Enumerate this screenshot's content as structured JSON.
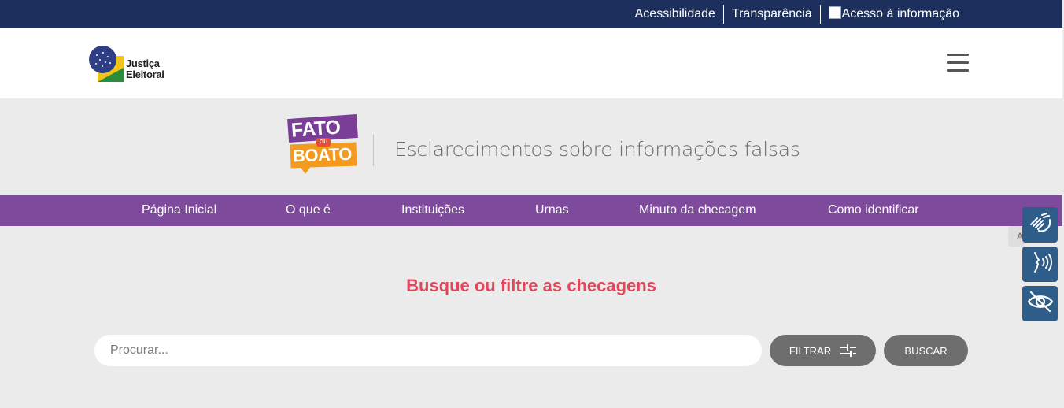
{
  "topbar": {
    "links": [
      "Acessibilidade",
      "Transparência",
      "Acesso à informação"
    ]
  },
  "header": {
    "logo_lines": [
      "Justiça",
      "Eleitoral"
    ],
    "menu_icon": "hamburger-icon"
  },
  "banner": {
    "logo_top": "FATO",
    "logo_mid": "OU",
    "logo_bottom": "BOATO",
    "tagline": "Esclarecimentos sobre informações falsas"
  },
  "nav": {
    "items": [
      "Página Inicial",
      "O que é",
      "Instituições",
      "Urnas",
      "Minuto da checagem",
      "Como identificar"
    ]
  },
  "main": {
    "title": "Busque ou filtre as checagens",
    "search_placeholder": "Procurar...",
    "filter_label": "FILTRAR",
    "search_button": "BUSCAR"
  },
  "side_tools": {
    "tab_text": "A",
    "icons": [
      "sign-language-icon",
      "voice-reader-icon",
      "hide-eye-icon"
    ]
  },
  "colors": {
    "topbar": "#1d2f5c",
    "nav": "#7e4a9c",
    "title": "#e0475a",
    "buttons": "#6e6e6e",
    "side_tools": "#2f5d8a"
  }
}
